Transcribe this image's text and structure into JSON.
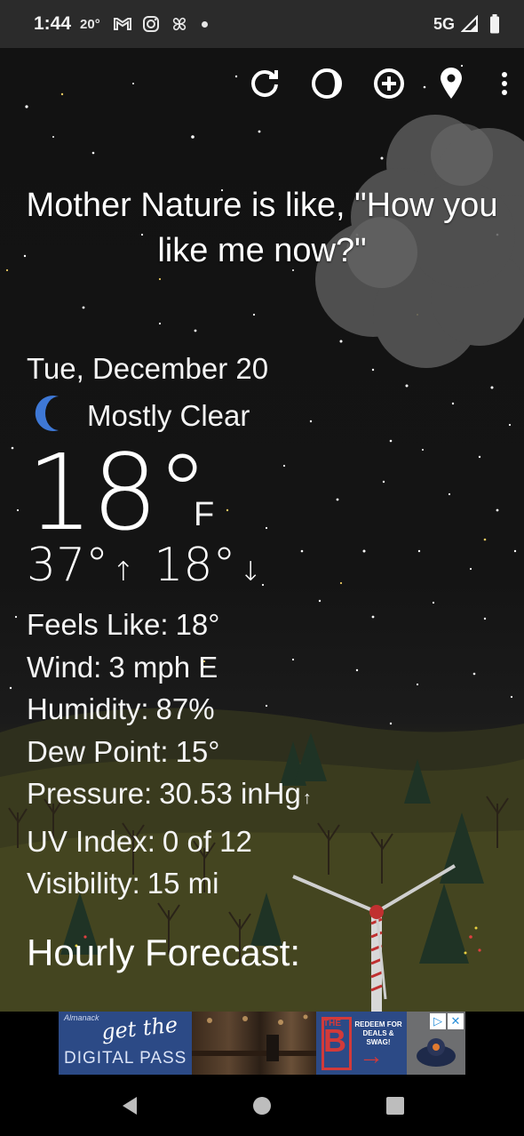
{
  "status_bar": {
    "time": "1:44",
    "temp": "20°",
    "network": "5G",
    "icons": [
      "gmail-icon",
      "instagram-icon",
      "pinwheel-app-icon",
      "notification-dot-icon",
      "signal-icon",
      "battery-icon"
    ]
  },
  "toolbar": {
    "icons": [
      "refresh-icon",
      "moon-phase-icon",
      "add-location-icon",
      "location-pin-icon",
      "more-vert-icon"
    ]
  },
  "headline": "Mother Nature is like, \"How you like me now?\"",
  "weather": {
    "date": "Tue, December 20",
    "condition": "Mostly Clear",
    "condition_icon": "crescent-moon-icon",
    "temperature": "18°",
    "unit": "F",
    "high": "37°",
    "low": "18°",
    "high_arrow": "↑",
    "low_arrow": "↓"
  },
  "details": {
    "feels_like": {
      "label": "Feels Like:",
      "value": "18°"
    },
    "wind": {
      "label": "Wind:",
      "value": "3 mph E"
    },
    "humidity": {
      "label": "Humidity:",
      "value": "87%"
    },
    "dew_point": {
      "label": "Dew Point:",
      "value": "15°"
    },
    "pressure": {
      "label": "Pressure:",
      "value": "30.53 inHg",
      "trend": "↑"
    },
    "uv_index": {
      "label": "UV Index:",
      "value": "0 of 12"
    },
    "visibility": {
      "label": "Visibility:",
      "value": "15 mi"
    }
  },
  "hourly_title": "Hourly Forecast:",
  "ad": {
    "brand": "Almanack",
    "script": "get the",
    "pass": "DIGITAL PASS",
    "the": "THE",
    "b_letter": "B",
    "redeem": "REDEEM FOR DEALS & SWAG!",
    "arrow": "→",
    "adchoices": "▷",
    "close": "✕"
  },
  "nav": {
    "icons": [
      "back-icon",
      "home-icon",
      "recents-icon"
    ]
  },
  "colors": {
    "sky": "#131313",
    "moon_icon": "#3e78d6",
    "ad_blue": "#2c4a86",
    "ad_red": "#d23a3a"
  }
}
